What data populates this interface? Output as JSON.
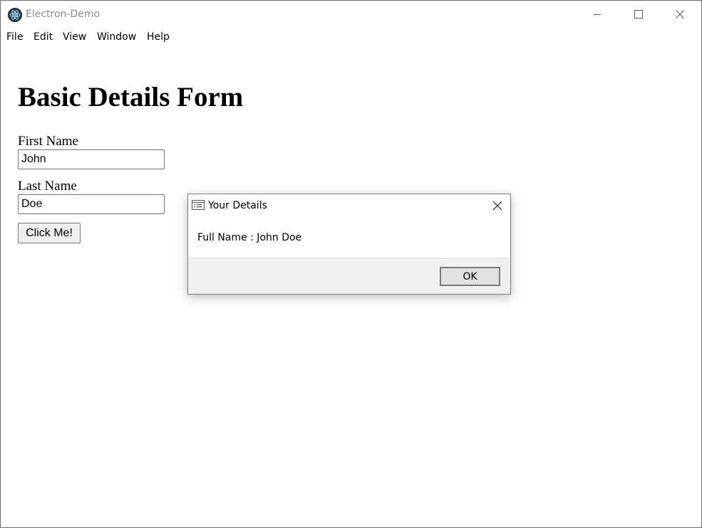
{
  "window": {
    "title": "Electron-Demo",
    "icon": "electron-logo-icon",
    "controls": {
      "minimize_icon": "minimize-icon",
      "maximize_icon": "maximize-icon",
      "close_icon": "close-icon"
    }
  },
  "menubar": {
    "items": [
      {
        "label": "File"
      },
      {
        "label": "Edit"
      },
      {
        "label": "View"
      },
      {
        "label": "Window"
      },
      {
        "label": "Help"
      }
    ]
  },
  "form": {
    "title": "Basic Details Form",
    "first_name": {
      "label": "First Name",
      "value": "John"
    },
    "last_name": {
      "label": "Last Name",
      "value": "Doe"
    },
    "submit_label": "Click Me!"
  },
  "dialog": {
    "title": "Your Details",
    "icon": "message-box-icon",
    "message": "Full Name : John Doe",
    "ok_label": "OK"
  },
  "colors": {
    "title_text": "#8a8a8a",
    "dialog_footer": "#f0f0f0",
    "button_face": "#e1e1e1"
  }
}
